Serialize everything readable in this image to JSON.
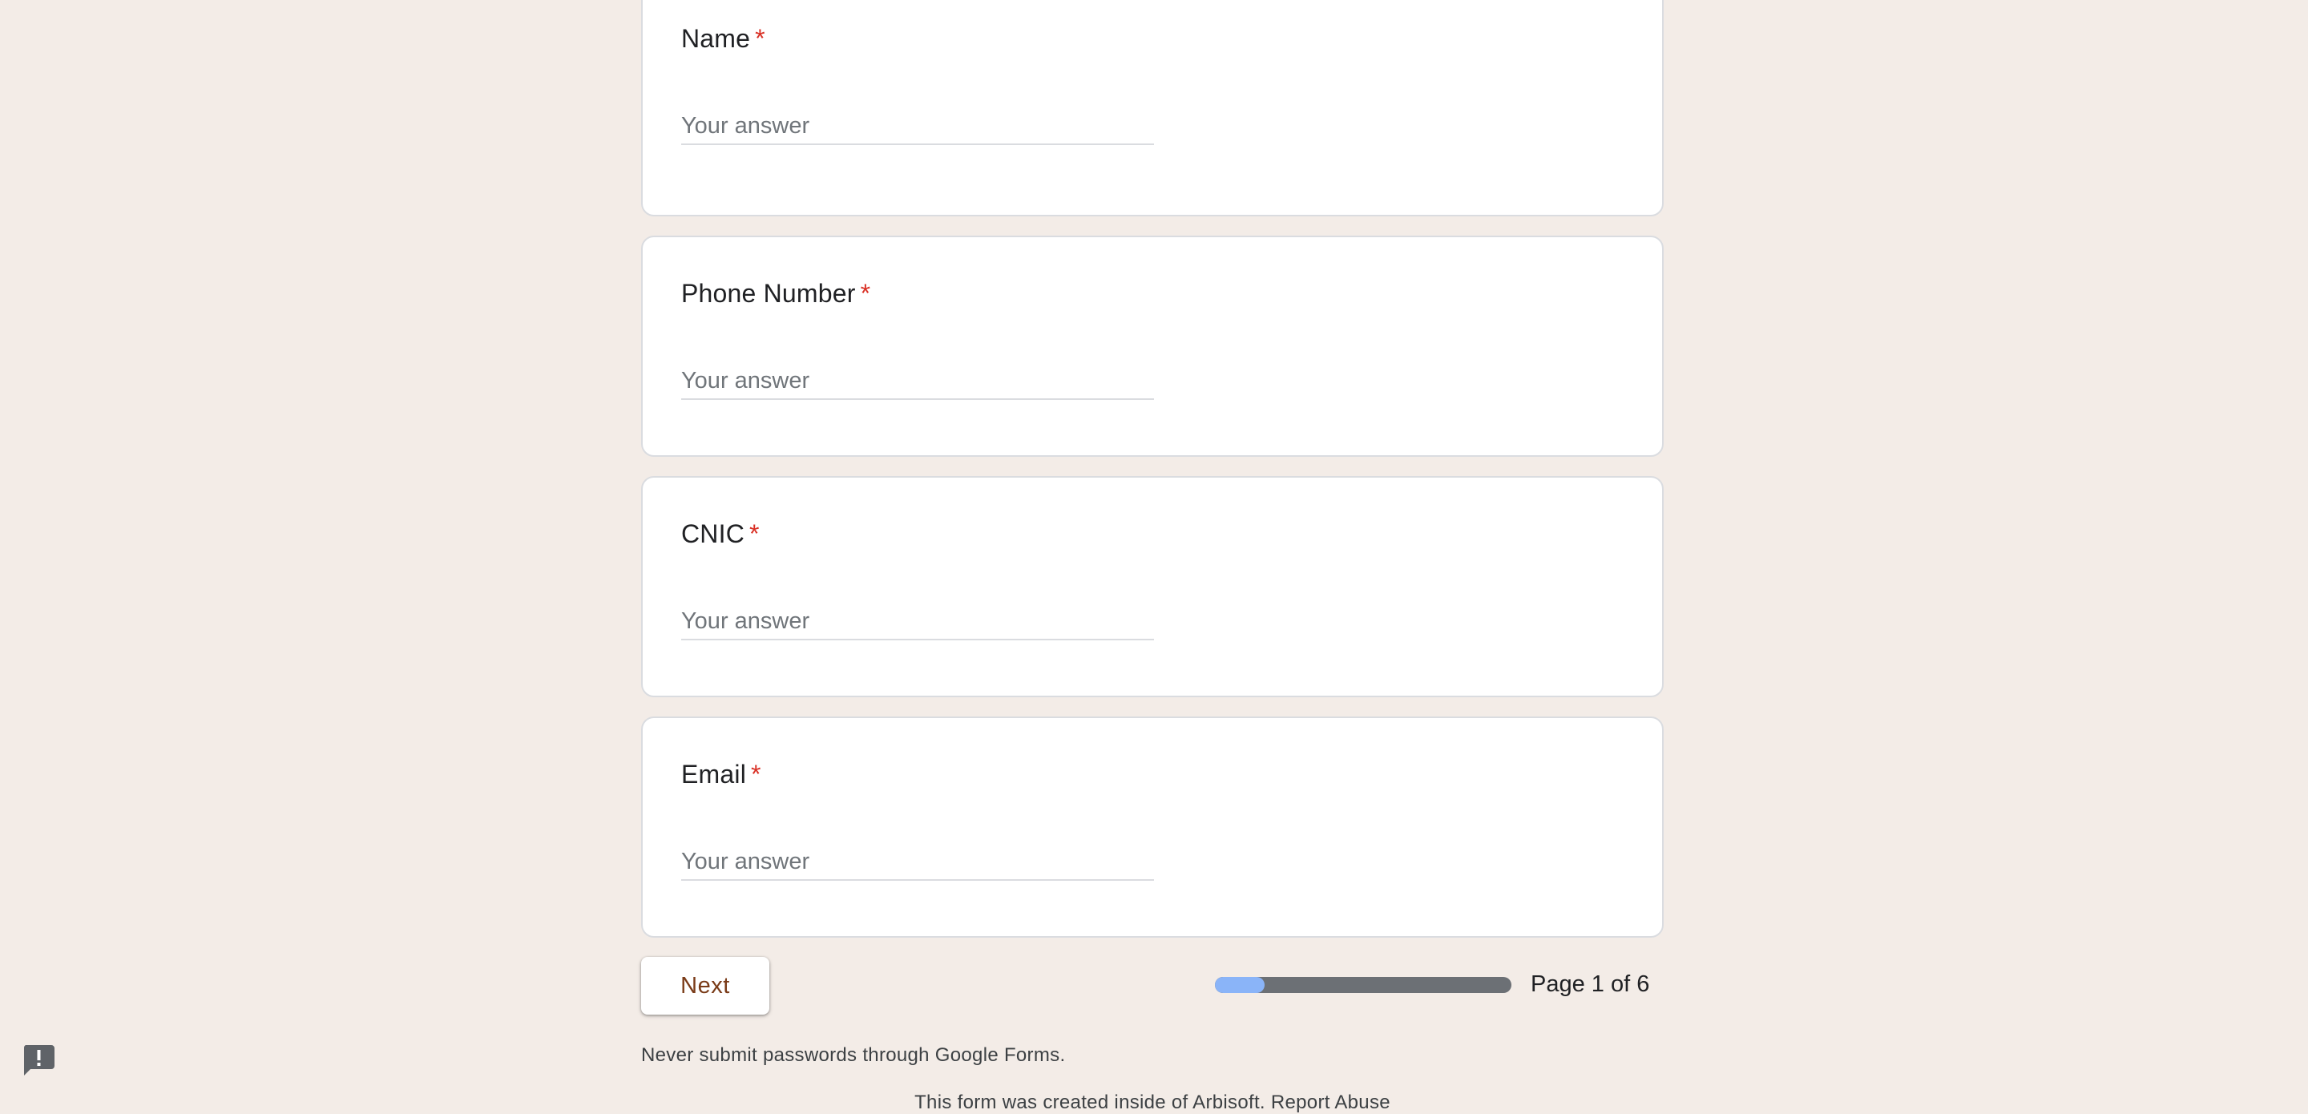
{
  "questions": [
    {
      "title": "Name",
      "required_mark": "*",
      "placeholder": "Your answer",
      "value": ""
    },
    {
      "title": "Phone Number",
      "required_mark": "*",
      "placeholder": "Your answer",
      "value": ""
    },
    {
      "title": "CNIC",
      "required_mark": "*",
      "placeholder": "Your answer",
      "value": ""
    },
    {
      "title": "Email",
      "required_mark": "*",
      "placeholder": "Your answer",
      "value": ""
    }
  ],
  "navigation": {
    "next_label": "Next",
    "page_text": "Page 1 of 6",
    "progress_fraction": 0.1667
  },
  "footer": {
    "notice": "Never submit passwords through Google Forms.",
    "created_text": "This form was created inside of Arbisoft.",
    "report_label": "Report Abuse"
  },
  "icons": {
    "report": "report-problem-icon"
  },
  "colors": {
    "page_background": "#f3ece7",
    "required": "#d93025",
    "next_text": "#7a3b18",
    "progress_fill": "#8ab4f8",
    "progress_track": "#6c7075"
  }
}
